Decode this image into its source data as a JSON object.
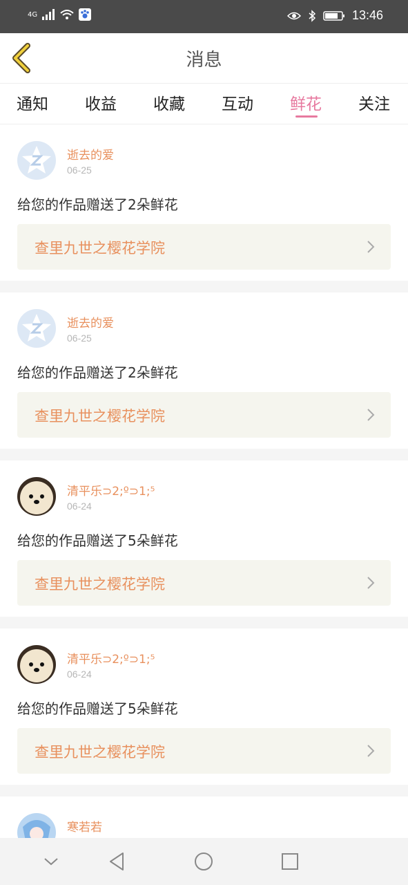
{
  "status": {
    "network": "4G",
    "time": "13:46"
  },
  "header": {
    "title": "消息"
  },
  "tabs": [
    {
      "label": "通知"
    },
    {
      "label": "收益"
    },
    {
      "label": "收藏"
    },
    {
      "label": "互动"
    },
    {
      "label": "鲜花"
    },
    {
      "label": "关注"
    }
  ],
  "active_tab": "鲜花",
  "colors": {
    "accent_pink": "#e7799f",
    "orange": "#e8905d"
  },
  "messages": [
    {
      "name": "逝去的爱",
      "date": "06-25",
      "text": "给您的作品赠送了2朵鲜花",
      "work": "查里九世之樱花学院",
      "avatar": "star-icon"
    },
    {
      "name": "逝去的爱",
      "date": "06-25",
      "text": "给您的作品赠送了2朵鲜花",
      "work": "查里九世之樱花学院",
      "avatar": "star-icon"
    },
    {
      "name": "清平乐⊃2;º⊃1;⁵",
      "date": "06-24",
      "text": "给您的作品赠送了5朵鲜花",
      "work": "查里九世之樱花学院",
      "avatar": "dog-avatar"
    },
    {
      "name": "清平乐⊃2;º⊃1;⁵",
      "date": "06-24",
      "text": "给您的作品赠送了5朵鲜花",
      "work": "查里九世之樱花学院",
      "avatar": "dog-avatar"
    },
    {
      "name": "寒若若",
      "date": "",
      "text": "",
      "work": "",
      "avatar": "anime-avatar"
    }
  ]
}
